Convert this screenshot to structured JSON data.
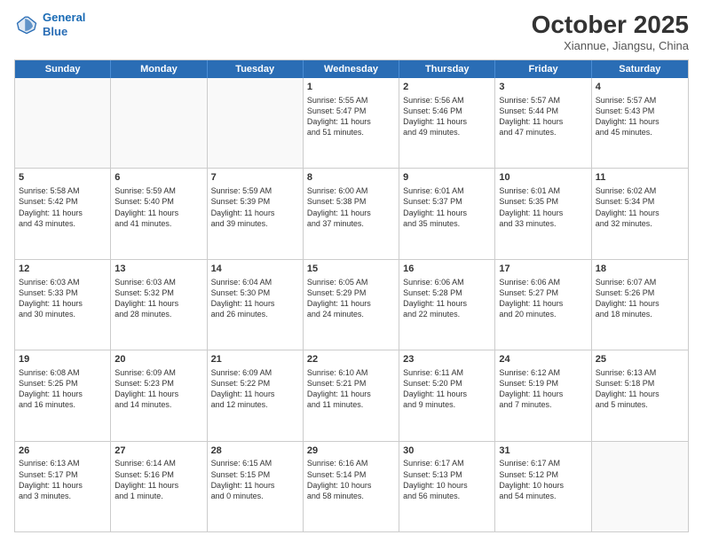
{
  "header": {
    "logo_line1": "General",
    "logo_line2": "Blue",
    "month_title": "October 2025",
    "location": "Xiannue, Jiangsu, China"
  },
  "day_headers": [
    "Sunday",
    "Monday",
    "Tuesday",
    "Wednesday",
    "Thursday",
    "Friday",
    "Saturday"
  ],
  "weeks": [
    [
      {
        "day": "",
        "info": ""
      },
      {
        "day": "",
        "info": ""
      },
      {
        "day": "",
        "info": ""
      },
      {
        "day": "1",
        "info": "Sunrise: 5:55 AM\nSunset: 5:47 PM\nDaylight: 11 hours\nand 51 minutes."
      },
      {
        "day": "2",
        "info": "Sunrise: 5:56 AM\nSunset: 5:46 PM\nDaylight: 11 hours\nand 49 minutes."
      },
      {
        "day": "3",
        "info": "Sunrise: 5:57 AM\nSunset: 5:44 PM\nDaylight: 11 hours\nand 47 minutes."
      },
      {
        "day": "4",
        "info": "Sunrise: 5:57 AM\nSunset: 5:43 PM\nDaylight: 11 hours\nand 45 minutes."
      }
    ],
    [
      {
        "day": "5",
        "info": "Sunrise: 5:58 AM\nSunset: 5:42 PM\nDaylight: 11 hours\nand 43 minutes."
      },
      {
        "day": "6",
        "info": "Sunrise: 5:59 AM\nSunset: 5:40 PM\nDaylight: 11 hours\nand 41 minutes."
      },
      {
        "day": "7",
        "info": "Sunrise: 5:59 AM\nSunset: 5:39 PM\nDaylight: 11 hours\nand 39 minutes."
      },
      {
        "day": "8",
        "info": "Sunrise: 6:00 AM\nSunset: 5:38 PM\nDaylight: 11 hours\nand 37 minutes."
      },
      {
        "day": "9",
        "info": "Sunrise: 6:01 AM\nSunset: 5:37 PM\nDaylight: 11 hours\nand 35 minutes."
      },
      {
        "day": "10",
        "info": "Sunrise: 6:01 AM\nSunset: 5:35 PM\nDaylight: 11 hours\nand 33 minutes."
      },
      {
        "day": "11",
        "info": "Sunrise: 6:02 AM\nSunset: 5:34 PM\nDaylight: 11 hours\nand 32 minutes."
      }
    ],
    [
      {
        "day": "12",
        "info": "Sunrise: 6:03 AM\nSunset: 5:33 PM\nDaylight: 11 hours\nand 30 minutes."
      },
      {
        "day": "13",
        "info": "Sunrise: 6:03 AM\nSunset: 5:32 PM\nDaylight: 11 hours\nand 28 minutes."
      },
      {
        "day": "14",
        "info": "Sunrise: 6:04 AM\nSunset: 5:30 PM\nDaylight: 11 hours\nand 26 minutes."
      },
      {
        "day": "15",
        "info": "Sunrise: 6:05 AM\nSunset: 5:29 PM\nDaylight: 11 hours\nand 24 minutes."
      },
      {
        "day": "16",
        "info": "Sunrise: 6:06 AM\nSunset: 5:28 PM\nDaylight: 11 hours\nand 22 minutes."
      },
      {
        "day": "17",
        "info": "Sunrise: 6:06 AM\nSunset: 5:27 PM\nDaylight: 11 hours\nand 20 minutes."
      },
      {
        "day": "18",
        "info": "Sunrise: 6:07 AM\nSunset: 5:26 PM\nDaylight: 11 hours\nand 18 minutes."
      }
    ],
    [
      {
        "day": "19",
        "info": "Sunrise: 6:08 AM\nSunset: 5:25 PM\nDaylight: 11 hours\nand 16 minutes."
      },
      {
        "day": "20",
        "info": "Sunrise: 6:09 AM\nSunset: 5:23 PM\nDaylight: 11 hours\nand 14 minutes."
      },
      {
        "day": "21",
        "info": "Sunrise: 6:09 AM\nSunset: 5:22 PM\nDaylight: 11 hours\nand 12 minutes."
      },
      {
        "day": "22",
        "info": "Sunrise: 6:10 AM\nSunset: 5:21 PM\nDaylight: 11 hours\nand 11 minutes."
      },
      {
        "day": "23",
        "info": "Sunrise: 6:11 AM\nSunset: 5:20 PM\nDaylight: 11 hours\nand 9 minutes."
      },
      {
        "day": "24",
        "info": "Sunrise: 6:12 AM\nSunset: 5:19 PM\nDaylight: 11 hours\nand 7 minutes."
      },
      {
        "day": "25",
        "info": "Sunrise: 6:13 AM\nSunset: 5:18 PM\nDaylight: 11 hours\nand 5 minutes."
      }
    ],
    [
      {
        "day": "26",
        "info": "Sunrise: 6:13 AM\nSunset: 5:17 PM\nDaylight: 11 hours\nand 3 minutes."
      },
      {
        "day": "27",
        "info": "Sunrise: 6:14 AM\nSunset: 5:16 PM\nDaylight: 11 hours\nand 1 minute."
      },
      {
        "day": "28",
        "info": "Sunrise: 6:15 AM\nSunset: 5:15 PM\nDaylight: 11 hours\nand 0 minutes."
      },
      {
        "day": "29",
        "info": "Sunrise: 6:16 AM\nSunset: 5:14 PM\nDaylight: 10 hours\nand 58 minutes."
      },
      {
        "day": "30",
        "info": "Sunrise: 6:17 AM\nSunset: 5:13 PM\nDaylight: 10 hours\nand 56 minutes."
      },
      {
        "day": "31",
        "info": "Sunrise: 6:17 AM\nSunset: 5:12 PM\nDaylight: 10 hours\nand 54 minutes."
      },
      {
        "day": "",
        "info": ""
      }
    ]
  ]
}
